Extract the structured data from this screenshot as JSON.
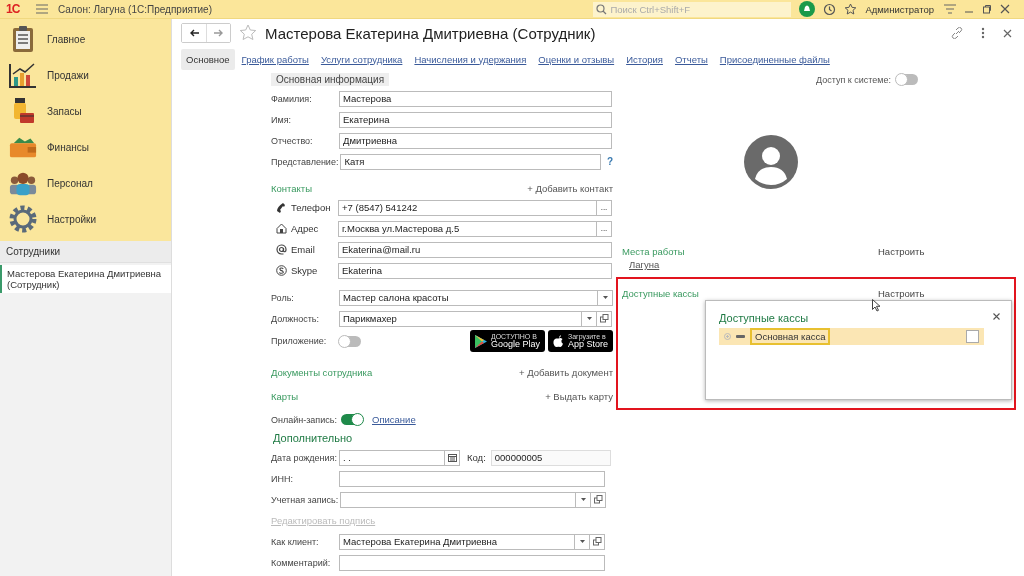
{
  "app_bar": {
    "logo": "1С",
    "title": "Салон: Лагуна  (1С:Предприятие)",
    "search": {
      "placeholder": "Поиск Ctrl+Shift+F"
    },
    "user": "Администратор"
  },
  "sidebar": {
    "sections": [
      {
        "kind": "clipboard",
        "label": "Главное"
      },
      {
        "kind": "chart",
        "label": "Продажи"
      },
      {
        "kind": "stock",
        "label": "Запасы"
      },
      {
        "kind": "wallet",
        "label": "Финансы"
      },
      {
        "kind": "people",
        "label": "Персонал"
      },
      {
        "kind": "gear",
        "label": "Настройки"
      }
    ],
    "open_title": "Сотрудники",
    "open_windows": [
      {
        "label": "Мастерова Екатерина Дмитриевна (Сотрудник)",
        "selected": true
      }
    ]
  },
  "form": {
    "title": "Мастерова Екатерина Дмитриевна (Сотрудник)",
    "favorite": false,
    "tabs": [
      {
        "label": "Основное",
        "selected": true
      },
      {
        "label": "График работы",
        "selected": false
      },
      {
        "label": "Услуги сотрудника",
        "selected": false
      },
      {
        "label": "Начисления и удержания",
        "selected": false
      },
      {
        "label": "Оценки и отзывы",
        "selected": false
      },
      {
        "label": "История",
        "selected": false
      },
      {
        "label": "Отчеты",
        "selected": false
      },
      {
        "label": "Присоединенные файлы",
        "selected": false
      }
    ],
    "section_title": "Основная информация",
    "system_access": {
      "label": "Доступ к системе:",
      "on": false
    },
    "name_fields": [
      {
        "label": "Фамилия:",
        "value": "Мастерова"
      },
      {
        "label": "Имя:",
        "value": "Екатерина"
      },
      {
        "label": "Отчество:",
        "value": "Дмитриевна"
      },
      {
        "label": "Представление:",
        "value": "Катя",
        "help": "?"
      }
    ],
    "contacts": {
      "title": "Контакты",
      "add": "+ Добавить контакт",
      "items": [
        {
          "kind": "phone",
          "label": "Телефон",
          "value": "+7 (8547) 541242",
          "button": "..."
        },
        {
          "kind": "address",
          "label": "Адрес",
          "value": "г.Москва ул.Мастерова д.5",
          "button": "..."
        },
        {
          "kind": "email",
          "label": "Email",
          "value": "Ekaterina@mail.ru"
        },
        {
          "kind": "skype",
          "label": "Skype",
          "value": "Ekaterina"
        }
      ]
    },
    "role": {
      "label": "Роль:",
      "value": "Мастер салона красоты"
    },
    "position": {
      "label": "Должность:",
      "value": "Парикмахер"
    },
    "app": {
      "label": "Приложение:",
      "on": false,
      "stores": [
        {
          "kind": "google",
          "caption": "ДОСТУПНО В",
          "name": "Google Play"
        },
        {
          "kind": "apple",
          "caption": "Загрузите в",
          "name": "App Store"
        }
      ]
    },
    "documents": {
      "title": "Документы сотрудника",
      "add": "+ Добавить документ"
    },
    "cards": {
      "title": "Карты",
      "add": "+ Выдать карту"
    },
    "online": {
      "label": "Онлайн-запись:",
      "on": true,
      "link": "Описание"
    },
    "extra_title": "Дополнительно",
    "birth_date": {
      "label": "Дата рождения:",
      "value": ". ."
    },
    "code": {
      "label": "Код:",
      "value": "000000005"
    },
    "inn": {
      "label": "ИНН:"
    },
    "account": {
      "label": "Учетная запись:"
    },
    "edit_signature": {
      "label": "Редактировать подпись",
      "disabled": true
    },
    "as_client": {
      "label": "Как клиент:",
      "value": "Мастерова Екатерина Дмитриевна"
    },
    "comment": {
      "label": "Комментарий:"
    },
    "workplaces": {
      "title": "Места работы",
      "setup": "Настроить",
      "items": [
        "Лагуна"
      ]
    },
    "cash_desks": {
      "title": "Доступные кассы",
      "setup": "Настроить",
      "popup": {
        "title": "Доступные кассы",
        "rows": [
          {
            "label": "Основная касса",
            "selected": true,
            "checked": false
          }
        ]
      }
    }
  }
}
